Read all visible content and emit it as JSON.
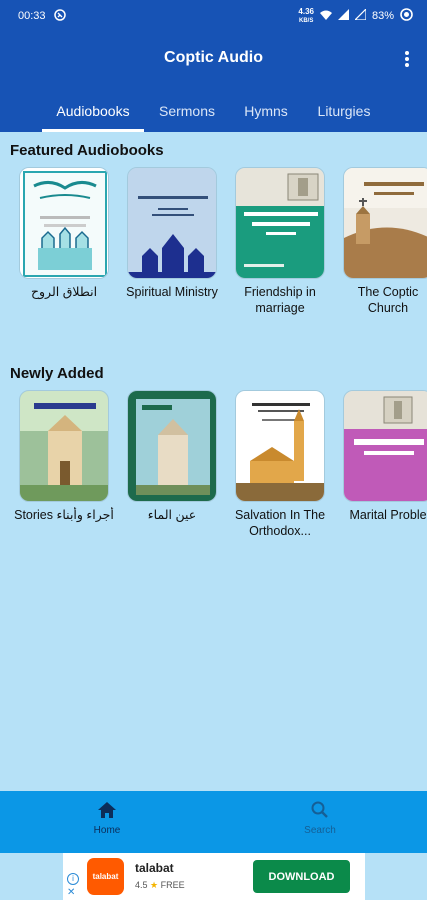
{
  "status_bar": {
    "time": "00:33",
    "net_speed_value": "4.36",
    "net_speed_unit": "KB/S",
    "battery": "83%"
  },
  "app_bar": {
    "title": "Coptic Audio",
    "menu_icon": "more-vert-icon"
  },
  "tabs": [
    {
      "label": "Audiobooks",
      "active": true
    },
    {
      "label": "Sermons",
      "active": false
    },
    {
      "label": "Hymns",
      "active": false
    },
    {
      "label": "Liturgies",
      "active": false
    }
  ],
  "sections": {
    "featured": {
      "title": "Featured Audiobooks",
      "items": [
        {
          "title": "انطلاق الروح"
        },
        {
          "title": "Spiritual Ministry"
        },
        {
          "title": "Friendship in marriage"
        },
        {
          "title": "The Coptic Church"
        }
      ]
    },
    "new": {
      "title": "Newly Added",
      "items": [
        {
          "title": "Stories أجراء وأبناء"
        },
        {
          "title": "عين الماء"
        },
        {
          "title": "Salvation In The Orthodox..."
        },
        {
          "title": "Marital Proble"
        }
      ]
    }
  },
  "bottom_nav": {
    "home": {
      "label": "Home",
      "icon": "home-icon",
      "active": true
    },
    "search": {
      "label": "Search",
      "icon": "search-icon",
      "active": false
    }
  },
  "ad": {
    "app_name": "talabat",
    "logo_text": "talabat",
    "rating": "4.5",
    "price": "FREE",
    "button_label": "DOWNLOAD"
  },
  "colors": {
    "app_bar": "#1753b5",
    "background": "#b6e1f7",
    "bottom_nav": "#0b97e6",
    "ad_button": "#0b8a4a"
  }
}
